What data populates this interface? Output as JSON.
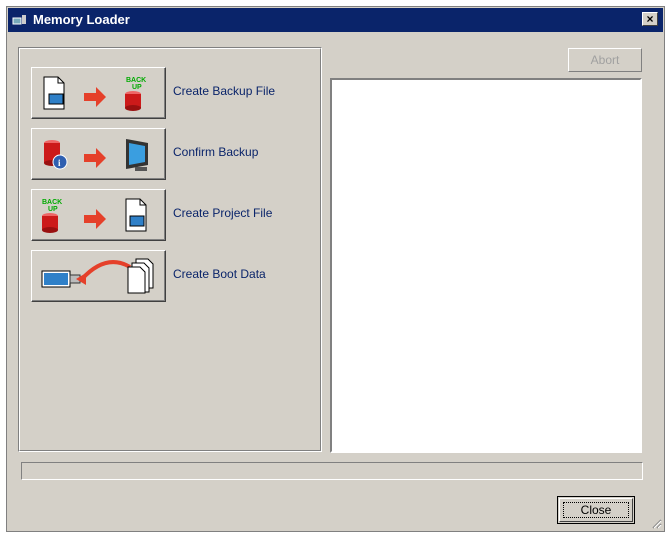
{
  "window": {
    "title": "Memory Loader"
  },
  "actions": [
    {
      "label": "Create Backup File",
      "icon": "document-to-backup-icon"
    },
    {
      "label": "Confirm Backup",
      "icon": "backup-to-monitor-icon"
    },
    {
      "label": "Create Project File",
      "icon": "backup-to-document-icon"
    },
    {
      "label": "Create Boot Data",
      "icon": "document-to-display-icon"
    }
  ],
  "buttons": {
    "abort": "Abort",
    "close": "Close"
  },
  "log": {
    "text": ""
  },
  "colors": {
    "titlebar": "#0a246a",
    "face": "#d4d0c8",
    "arrow": "#e5402a",
    "db": "#cc1a1a"
  }
}
